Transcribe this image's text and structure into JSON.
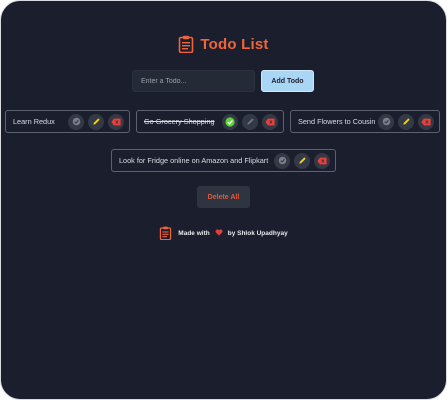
{
  "app": {
    "title": "Todo List",
    "icon": "clipboard-icon",
    "accent_color": "#f0643c"
  },
  "input": {
    "placeholder": "Enter a Todo...",
    "value": "",
    "add_label": "Add Todo"
  },
  "todos": [
    {
      "text": "Learn Redux",
      "completed": false
    },
    {
      "text": "Go Grocery Shopping",
      "completed": true
    },
    {
      "text": "Send Flowers to Cousin",
      "completed": false
    },
    {
      "text": "Look for Fridge online on Amazon and Flipkart",
      "completed": false
    }
  ],
  "actions": {
    "delete_all_label": "Delete All",
    "icons": [
      "check-circle-icon",
      "pencil-icon",
      "delete-icon"
    ]
  },
  "footer": {
    "made_with": "Made with",
    "by": "by Shlok Upadhyay",
    "heart_color": "#e0403c"
  }
}
